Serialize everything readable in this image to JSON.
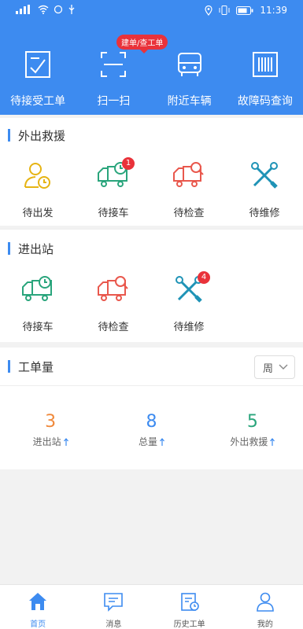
{
  "status": {
    "time": "11:39"
  },
  "topnav": [
    {
      "label": "待接受工单",
      "icon": "clipboard-check-icon"
    },
    {
      "label": "扫一扫",
      "icon": "scan-icon"
    },
    {
      "label": "附近车辆",
      "icon": "car-icon"
    },
    {
      "label": "故障码查询",
      "icon": "barcode-icon"
    }
  ],
  "bubble": "建单/查工单",
  "rescue": {
    "title": "外出救援",
    "items": [
      {
        "label": "待出发",
        "icon": "person-clock-icon",
        "color": "#e6b414"
      },
      {
        "label": "待接车",
        "icon": "truck-clock-icon",
        "color": "#2aa57c",
        "badge": "1"
      },
      {
        "label": "待检查",
        "icon": "truck-search-icon",
        "color": "#e9584d"
      },
      {
        "label": "待维修",
        "icon": "tools-icon",
        "color": "#1f93b6"
      }
    ]
  },
  "station": {
    "title": "进出站",
    "items": [
      {
        "label": "待接车",
        "icon": "truck-clock-icon",
        "color": "#2aa57c"
      },
      {
        "label": "待检查",
        "icon": "truck-search-icon",
        "color": "#e9584d"
      },
      {
        "label": "待维修",
        "icon": "tools-icon",
        "color": "#1f93b6",
        "badge": "4"
      }
    ]
  },
  "orders": {
    "title": "工单量",
    "period": "周",
    "stats": [
      {
        "value": "3",
        "label": "进出站",
        "color": "#f0893b"
      },
      {
        "value": "8",
        "label": "总量",
        "color": "#3d8bf0"
      },
      {
        "value": "5",
        "label": "外出救援",
        "color": "#2aa57c"
      }
    ]
  },
  "tabs": [
    {
      "label": "首页",
      "icon": "home-icon",
      "active": true
    },
    {
      "label": "消息",
      "icon": "message-icon"
    },
    {
      "label": "历史工单",
      "icon": "history-order-icon"
    },
    {
      "label": "我的",
      "icon": "user-icon"
    }
  ],
  "colors": {
    "primary": "#3d8bf0",
    "badge": "#e9323a"
  }
}
